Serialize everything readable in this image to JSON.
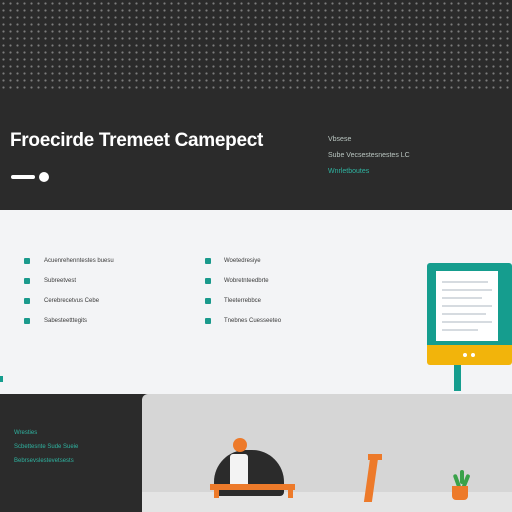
{
  "hero": {
    "title": "Froecirde Tremeet Camepect",
    "info_lines": [
      "Vbsese",
      "Sube Vecsestesnestes LC",
      "Wnrletboutes"
    ]
  },
  "features": {
    "left": [
      "Acuenrehenntestes buesu",
      "Subreetvest",
      "Cerebrecetvus Cebe",
      "Sabesteetttegits"
    ],
    "right": [
      "Woetedresiye",
      "Wobretnteedbrte",
      "Tleeterrebbce",
      "Tnebnes Cuesseeteo"
    ]
  },
  "footer": {
    "lines": [
      "Wresties",
      "Scbettesnte Sude Sueie",
      "Bebrsevslestevetsests"
    ]
  },
  "colors": {
    "dark": "#2b2b2b",
    "teal": "#159d8e",
    "orange": "#ed7a2a",
    "yellow": "#f2b40b",
    "light": "#f3f4f6"
  },
  "icons": [
    "slider-toggle-icon",
    "feature-icon",
    "monitor-illustration",
    "person-illustration",
    "lamp-illustration",
    "plant-illustration"
  ]
}
